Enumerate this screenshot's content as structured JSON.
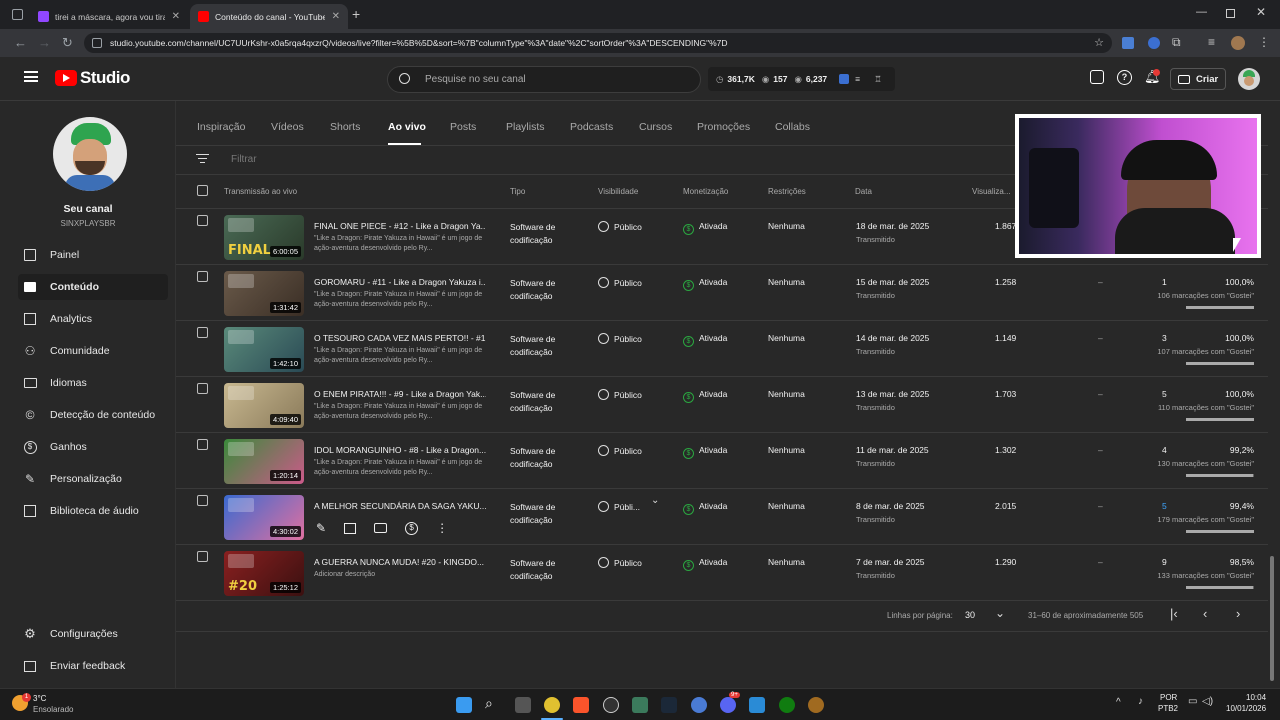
{
  "browser": {
    "tabs": [
      {
        "title": "tirei a máscara, agora vou tirar"
      },
      {
        "title": "Conteúdo do canal - YouTube S"
      }
    ],
    "new_tab": "+",
    "url": "studio.youtube.com/channel/UC7UUrKshr-x0a5rqa4qxzrQ/videos/live?filter=%5B%5D&sort=%7B\"columnType\"%3A\"date\"%2C\"sortOrder\"%3A\"DESCENDING\"%7D"
  },
  "header": {
    "logo_text": "Studio",
    "search_placeholder": "Pesquise no seu canal",
    "stats": {
      "views": "361,7K",
      "comments": "157",
      "watch": "6,237"
    },
    "create_label": "Criar"
  },
  "sidebar": {
    "channel_label": "Seu canal",
    "channel_handle": "SINXPLAYSBR",
    "items": [
      {
        "label": "Painel",
        "icon": "dashboard-icon"
      },
      {
        "label": "Conteúdo",
        "icon": "content-icon"
      },
      {
        "label": "Analytics",
        "icon": "analytics-icon"
      },
      {
        "label": "Comunidade",
        "icon": "community-icon"
      },
      {
        "label": "Idiomas",
        "icon": "subtitles-icon"
      },
      {
        "label": "Detecção de conteúdo",
        "icon": "copyright-icon"
      },
      {
        "label": "Ganhos",
        "icon": "earn-icon"
      },
      {
        "label": "Personalização",
        "icon": "customization-icon"
      },
      {
        "label": "Biblioteca de áudio",
        "icon": "audio-library-icon"
      }
    ],
    "settings_label": "Configurações",
    "feedback_label": "Enviar feedback"
  },
  "tabs": [
    "Inspiração",
    "Vídeos",
    "Shorts",
    "Ao vivo",
    "Posts",
    "Playlists",
    "Podcasts",
    "Cursos",
    "Promoções",
    "Collabs"
  ],
  "filter_placeholder": "Filtrar",
  "columns": {
    "live": "Transmissão ao vivo",
    "type": "Tipo",
    "visibility": "Visibilidade",
    "monetization": "Monetização",
    "restrictions": "Restrições",
    "date": "Data",
    "views": "Visualiza..."
  },
  "rows": [
    {
      "title": "FINAL ONE PIECE - #12 - Like a Dragon Ya...",
      "desc": "\"Like a Dragon: Pirate Yakuza in Hawaii\" é um jogo de ação-aventura desenvolvido pelo Ry...",
      "duration": "6:00:05",
      "thumb_text": "FINAL",
      "type1": "Software de",
      "type2": "codificação",
      "visibility": "Público",
      "monetization": "Ativada",
      "restrictions": "Nenhuma",
      "date": "18 de mar. de 2025",
      "date_sub": "Transmitido",
      "views": "1.867",
      "comments": "",
      "likes": "",
      "percent": "",
      "likes_text": "",
      "likes_fraction": 0
    },
    {
      "title": "GOROMARU - #11 - Like a Dragon Yakuza i...",
      "desc": "\"Like a Dragon: Pirate Yakuza in Hawaii\" é um jogo de ação-aventura desenvolvido pelo Ry...",
      "duration": "1:31:42",
      "thumb_text": "",
      "type1": "Software de",
      "type2": "codificação",
      "visibility": "Público",
      "monetization": "Ativada",
      "restrictions": "Nenhuma",
      "date": "15 de mar. de 2025",
      "date_sub": "Transmitido",
      "views": "1.258",
      "comments": "–",
      "likes": "1",
      "percent": "100,0%",
      "likes_text": "106 marcações com \"Gostei\"",
      "likes_fraction": 1.0
    },
    {
      "title": "O TESOURO CADA VEZ MAIS PERTO!! - #1...",
      "desc": "\"Like a Dragon: Pirate Yakuza in Hawaii\" é um jogo de ação-aventura desenvolvido pelo Ry...",
      "duration": "1:42:10",
      "thumb_text": "",
      "type1": "Software de",
      "type2": "codificação",
      "visibility": "Público",
      "monetization": "Ativada",
      "restrictions": "Nenhuma",
      "date": "14 de mar. de 2025",
      "date_sub": "Transmitido",
      "views": "1.149",
      "comments": "–",
      "likes": "3",
      "percent": "100,0%",
      "likes_text": "107 marcações com \"Gostei\"",
      "likes_fraction": 1.0
    },
    {
      "title": "O ENEM PIRATA!!! - #9 - Like a Dragon Yak...",
      "desc": "\"Like a Dragon: Pirate Yakuza in Hawaii\" é um jogo de ação-aventura desenvolvido pelo Ry...",
      "duration": "4:09:40",
      "thumb_text": "",
      "type1": "Software de",
      "type2": "codificação",
      "visibility": "Público",
      "monetization": "Ativada",
      "restrictions": "Nenhuma",
      "date": "13 de mar. de 2025",
      "date_sub": "Transmitido",
      "views": "1.703",
      "comments": "–",
      "likes": "5",
      "percent": "100,0%",
      "likes_text": "110 marcações com \"Gostei\"",
      "likes_fraction": 1.0
    },
    {
      "title": "IDOL MORANGUINHO - #8 - Like a Dragon...",
      "desc": "\"Like a Dragon: Pirate Yakuza in Hawaii\" é um jogo de ação-aventura desenvolvido pelo Ry...",
      "duration": "1:20:14",
      "thumb_text": "",
      "type1": "Software de",
      "type2": "codificação",
      "visibility": "Público",
      "monetization": "Ativada",
      "restrictions": "Nenhuma",
      "date": "11 de mar. de 2025",
      "date_sub": "Transmitido",
      "views": "1.302",
      "comments": "–",
      "likes": "4",
      "percent": "99,2%",
      "likes_text": "130 marcações com \"Gostei\"",
      "likes_fraction": 0.992
    },
    {
      "title": "A MELHOR SECUNDÁRIA DA SAGA YAKU...",
      "desc": "",
      "duration": "4:30:02",
      "thumb_text": "",
      "type1": "Software de",
      "type2": "codificação",
      "visibility": "Públi...",
      "monetization": "Ativada",
      "restrictions": "Nenhuma",
      "date": "8 de mar. de 2025",
      "date_sub": "Transmitido",
      "views": "2.015",
      "comments": "–",
      "likes": "5",
      "percent": "99,4%",
      "likes_text": "179 marcações com \"Gostei\"",
      "likes_fraction": 0.994
    },
    {
      "title": "A GUERRA NUNCA MUDA! #20 - KINGDO...",
      "desc": "Adicionar descrição",
      "duration": "1:25:12",
      "thumb_text": "#20",
      "type1": "Software de",
      "type2": "codificação",
      "visibility": "Público",
      "monetization": "Ativada",
      "restrictions": "Nenhuma",
      "date": "7 de mar. de 2025",
      "date_sub": "Transmitido",
      "views": "1.290",
      "comments": "–",
      "likes": "9",
      "percent": "98,5%",
      "likes_text": "133 marcações com \"Gostei\"",
      "likes_fraction": 0.985
    }
  ],
  "pagination": {
    "rows_label": "Linhas por página:",
    "rows_value": "30",
    "range": "31–60 de aproximadamente 505"
  },
  "taskbar": {
    "weather_temp": "3°C",
    "weather_desc": "Ensolarado",
    "lang1": "POR",
    "lang2": "PTB2",
    "time": "10:04",
    "date": "10/01/2026",
    "discord_badge": "9+"
  }
}
